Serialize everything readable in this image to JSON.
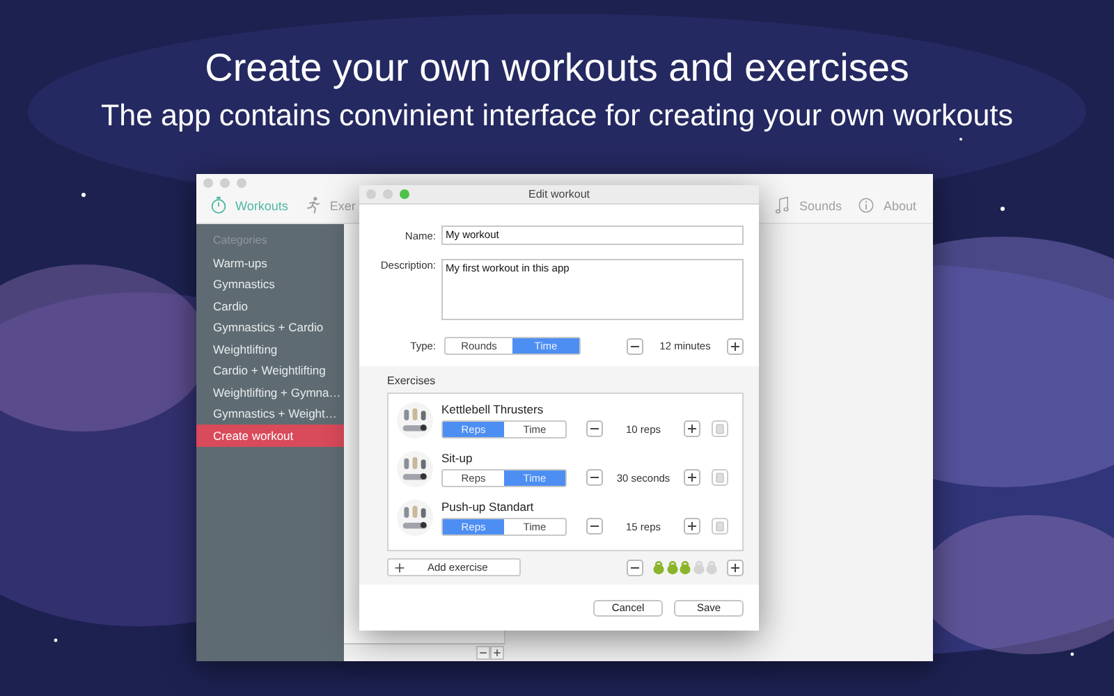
{
  "headline": {
    "title": "Create your own workouts and exercises",
    "subtitle": "The app contains convinient interface for creating your own workouts"
  },
  "toolbar": {
    "tabs": [
      {
        "label": "Workouts",
        "kind": "stopwatch",
        "selected": true
      },
      {
        "label": "Exer",
        "kind": "runner",
        "selected": false
      },
      {
        "label": "Sounds",
        "kind": "note",
        "selected": false
      },
      {
        "label": "About",
        "kind": "info",
        "selected": false
      }
    ]
  },
  "sidebar": {
    "heading": "Categories",
    "items": [
      {
        "label": "Warm-ups",
        "selected": false
      },
      {
        "label": "Gymnastics",
        "selected": false
      },
      {
        "label": "Cardio",
        "selected": false
      },
      {
        "label": "Gymnastics + Cardio",
        "selected": false
      },
      {
        "label": "Weightlifting",
        "selected": false
      },
      {
        "label": "Cardio + Weightlifting",
        "selected": false
      },
      {
        "label": "Weightlifting + Gymna…",
        "selected": false
      },
      {
        "label": "Gymnastics + Weight…",
        "selected": false
      },
      {
        "label": "Create workout",
        "selected": true
      }
    ]
  },
  "dialog": {
    "title": "Edit workout",
    "name_label": "Name:",
    "name_value": "My workout",
    "description_label": "Description:",
    "description_value": "My first workout in this app",
    "type_label": "Type:",
    "type_options": [
      {
        "label": "Rounds",
        "selected": false
      },
      {
        "label": "Time",
        "selected": true
      }
    ],
    "duration": "12 minutes",
    "exercises_heading": "Exercises",
    "exercises": [
      {
        "name": "Kettlebell Thrusters",
        "modes": [
          {
            "label": "Reps",
            "selected": true
          },
          {
            "label": "Time",
            "selected": false
          }
        ],
        "amount": "10 reps"
      },
      {
        "name": "Sit-up",
        "modes": [
          {
            "label": "Reps",
            "selected": false
          },
          {
            "label": "Time",
            "selected": true
          }
        ],
        "amount": "30 seconds"
      },
      {
        "name": "Push-up Standart",
        "modes": [
          {
            "label": "Reps",
            "selected": true
          },
          {
            "label": "Time",
            "selected": false
          }
        ],
        "amount": "15 reps"
      }
    ],
    "add_label": "Add exercise",
    "difficulty": {
      "stars": 3
    },
    "buttons": [
      {
        "label": "Cancel"
      },
      {
        "label": "Save"
      }
    ]
  }
}
